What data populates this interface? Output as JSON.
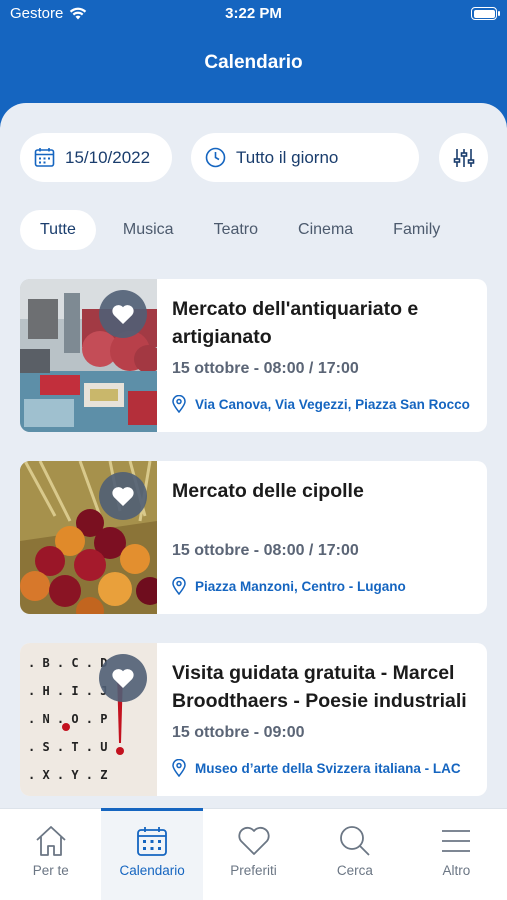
{
  "status_bar": {
    "carrier": "Gestore",
    "time": "3:22 PM"
  },
  "header": {
    "title": "Calendario"
  },
  "filters": {
    "date": "15/10/2022",
    "time": "Tutto il giorno"
  },
  "categories": [
    "Tutte",
    "Musica",
    "Teatro",
    "Cinema",
    "Family"
  ],
  "events": [
    {
      "title": "Mercato dell'antiquariato e artigianato",
      "date": "15 ottobre - 08:00 / 17:00",
      "location": "Via Canova, Via Vegezzi, Piazza San Rocco"
    },
    {
      "title": "Mercato delle cipolle",
      "date": "15 ottobre - 08:00 / 17:00",
      "location": "Piazza Manzoni, Centro - Lugano"
    },
    {
      "title": "Visita guidata gratuita - Marcel Broodthaers - Poesie industriali",
      "date": "15 ottobre - 09:00",
      "location": "Museo d’arte della Svizzera italiana - LAC"
    }
  ],
  "tabbar": [
    {
      "label": "Per te",
      "icon": "home-icon"
    },
    {
      "label": "Calendario",
      "icon": "calendar-icon"
    },
    {
      "label": "Preferiti",
      "icon": "heart-icon"
    },
    {
      "label": "Cerca",
      "icon": "search-icon"
    },
    {
      "label": "Altro",
      "icon": "menu-icon"
    }
  ],
  "colors": {
    "primary": "#1565c0",
    "background": "#e8edf4",
    "heart_button": "#505f76"
  }
}
